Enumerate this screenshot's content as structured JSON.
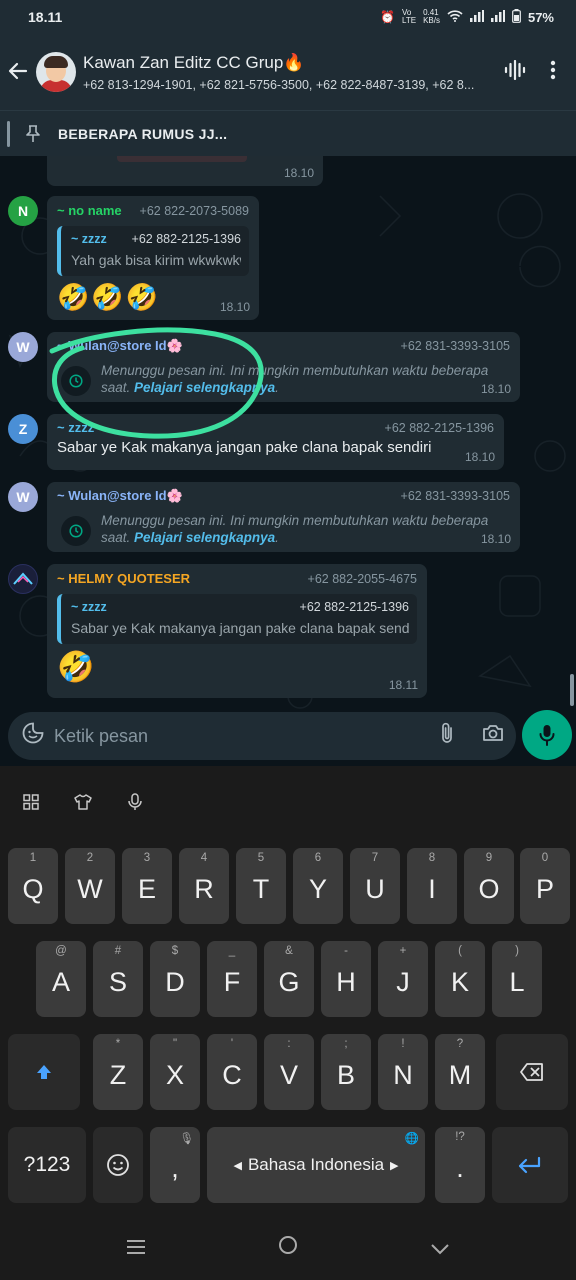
{
  "status": {
    "time": "18.11",
    "net1": "VoLTE",
    "net1_speed": "0.41 KB/s",
    "battery": "57%"
  },
  "header": {
    "title": "Kawan Zan Editz CC Grup🔥",
    "members": "+62 813-1294-1901, +62 821-5756-3500, +62 822-8487-3139, +62 8..."
  },
  "pinned": {
    "text": "BEBERAPA RUMUS JJ..."
  },
  "messages": {
    "top_time": "18.10",
    "m1": {
      "avatar": "N",
      "avatar_color": "#25a244",
      "name": "~ no name",
      "name_color": "#25d366",
      "phone": "+62 822-2073-5089",
      "quote_name": "~ zzzz",
      "quote_phone": "+62 882-2125-1396",
      "quote_text": "Yah gak bisa kirim wkwkwkw",
      "emoji": "🤣🤣🤣",
      "time": "18.10"
    },
    "m2": {
      "avatar": "W",
      "avatar_color": "#9aa8d8",
      "name": "~ Wulan@store Id🌸",
      "name_color": "#8ab4f8",
      "phone": "+62 831-3393-3105",
      "waiting": "Menunggu pesan ini. Ini mungkin membutuhkan waktu beberapa saat.",
      "link": "Pelajari selengkapnya",
      "time": "18.10"
    },
    "m3": {
      "avatar": "Z",
      "avatar_color": "#4a8fd6",
      "name": "~ zzzz",
      "name_color": "#53bdeb",
      "phone": "+62 882-2125-1396",
      "text": "Sabar ye Kak makanya jangan pake clana bapak sendiri",
      "time": "18.10"
    },
    "m4": {
      "avatar": "W",
      "avatar_color": "#9aa8d8",
      "name": "~ Wulan@store Id🌸",
      "name_color": "#8ab4f8",
      "phone": "+62 831-3393-3105",
      "waiting": "Menunggu pesan ini. Ini mungkin membutuhkan waktu beberapa saat.",
      "link": "Pelajari selengkapnya",
      "time": "18.10"
    },
    "m5": {
      "name": "~ HELMY QUOTESER",
      "name_color": "#f5a623",
      "phone": "+62 882-2055-4675",
      "quote_name": "~ zzzz",
      "quote_phone": "+62 882-2125-1396",
      "quote_text": "Sabar ye Kak makanya jangan pake clana bapak sendiri",
      "emoji": "🤣",
      "time": "18.11"
    }
  },
  "input": {
    "placeholder": "Ketik pesan"
  },
  "keyboard": {
    "row1": [
      [
        "1",
        "Q"
      ],
      [
        "2",
        "W"
      ],
      [
        "3",
        "E"
      ],
      [
        "4",
        "R"
      ],
      [
        "5",
        "T"
      ],
      [
        "6",
        "Y"
      ],
      [
        "7",
        "U"
      ],
      [
        "8",
        "I"
      ],
      [
        "9",
        "O"
      ],
      [
        "0",
        "P"
      ]
    ],
    "row2": [
      [
        "@",
        "A"
      ],
      [
        "#",
        "S"
      ],
      [
        "$",
        "D"
      ],
      [
        "_",
        "F"
      ],
      [
        "&",
        "G"
      ],
      [
        "-",
        "H"
      ],
      [
        "+",
        "J"
      ],
      [
        "(",
        "K"
      ],
      [
        ")",
        "L"
      ]
    ],
    "row3": [
      [
        "*",
        "Z"
      ],
      [
        "\"",
        "X"
      ],
      [
        "'",
        "C"
      ],
      [
        ":",
        "V"
      ],
      [
        ";",
        "B"
      ],
      [
        "!",
        "N"
      ],
      [
        "?",
        "M"
      ]
    ],
    "sym_key": "?123",
    "comma": ",",
    "space_label": "Bahasa Indonesia",
    "period_hint": "!?",
    "period": "."
  },
  "colors": {
    "accent": "#00a884",
    "bubble": "#202c33",
    "background": "#0b141a",
    "link": "#53bdeb",
    "annotation": "#3de0a0"
  }
}
